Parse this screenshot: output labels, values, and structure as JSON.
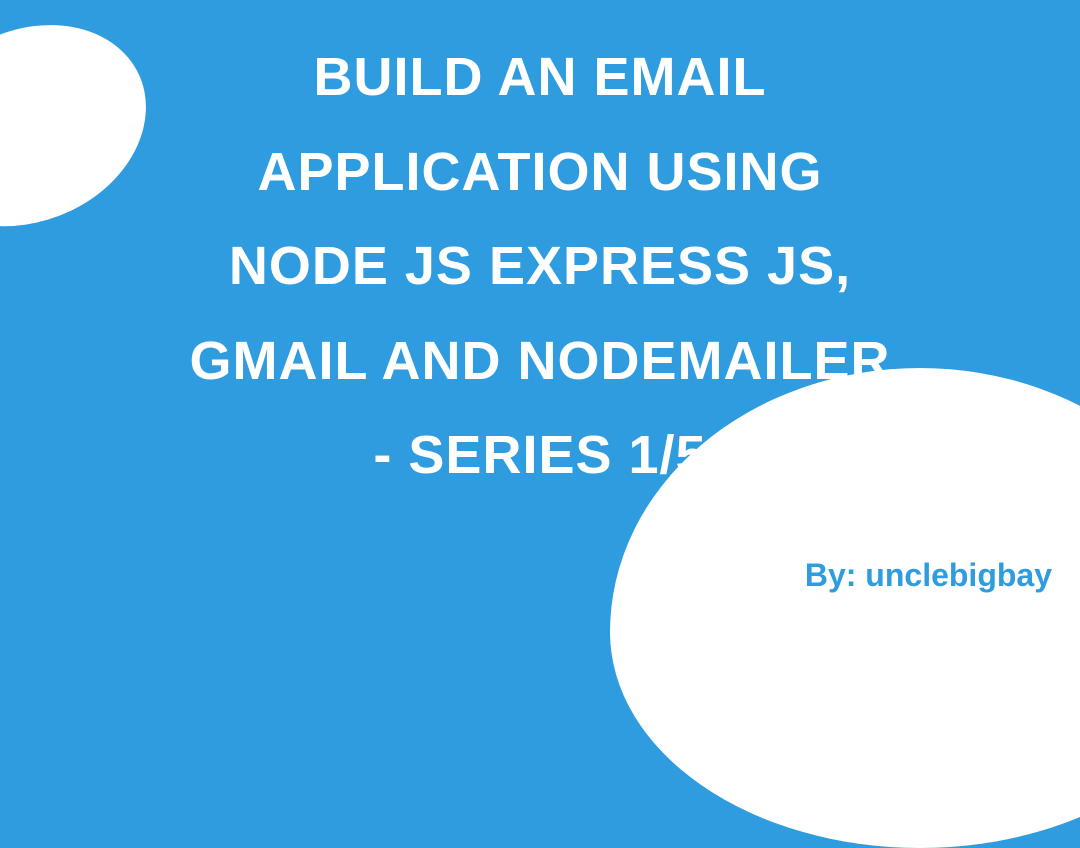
{
  "title": {
    "line1": "Build an email",
    "line2": "Application using",
    "line3": "Node Js Express Js,",
    "line4": "Gmail and Nodemailer",
    "line5": "- Series 1/5"
  },
  "byline": "By: unclebigbay",
  "colors": {
    "background": "#2e9cdf",
    "text": "#ffffff",
    "accent": "#2e9cdf"
  }
}
